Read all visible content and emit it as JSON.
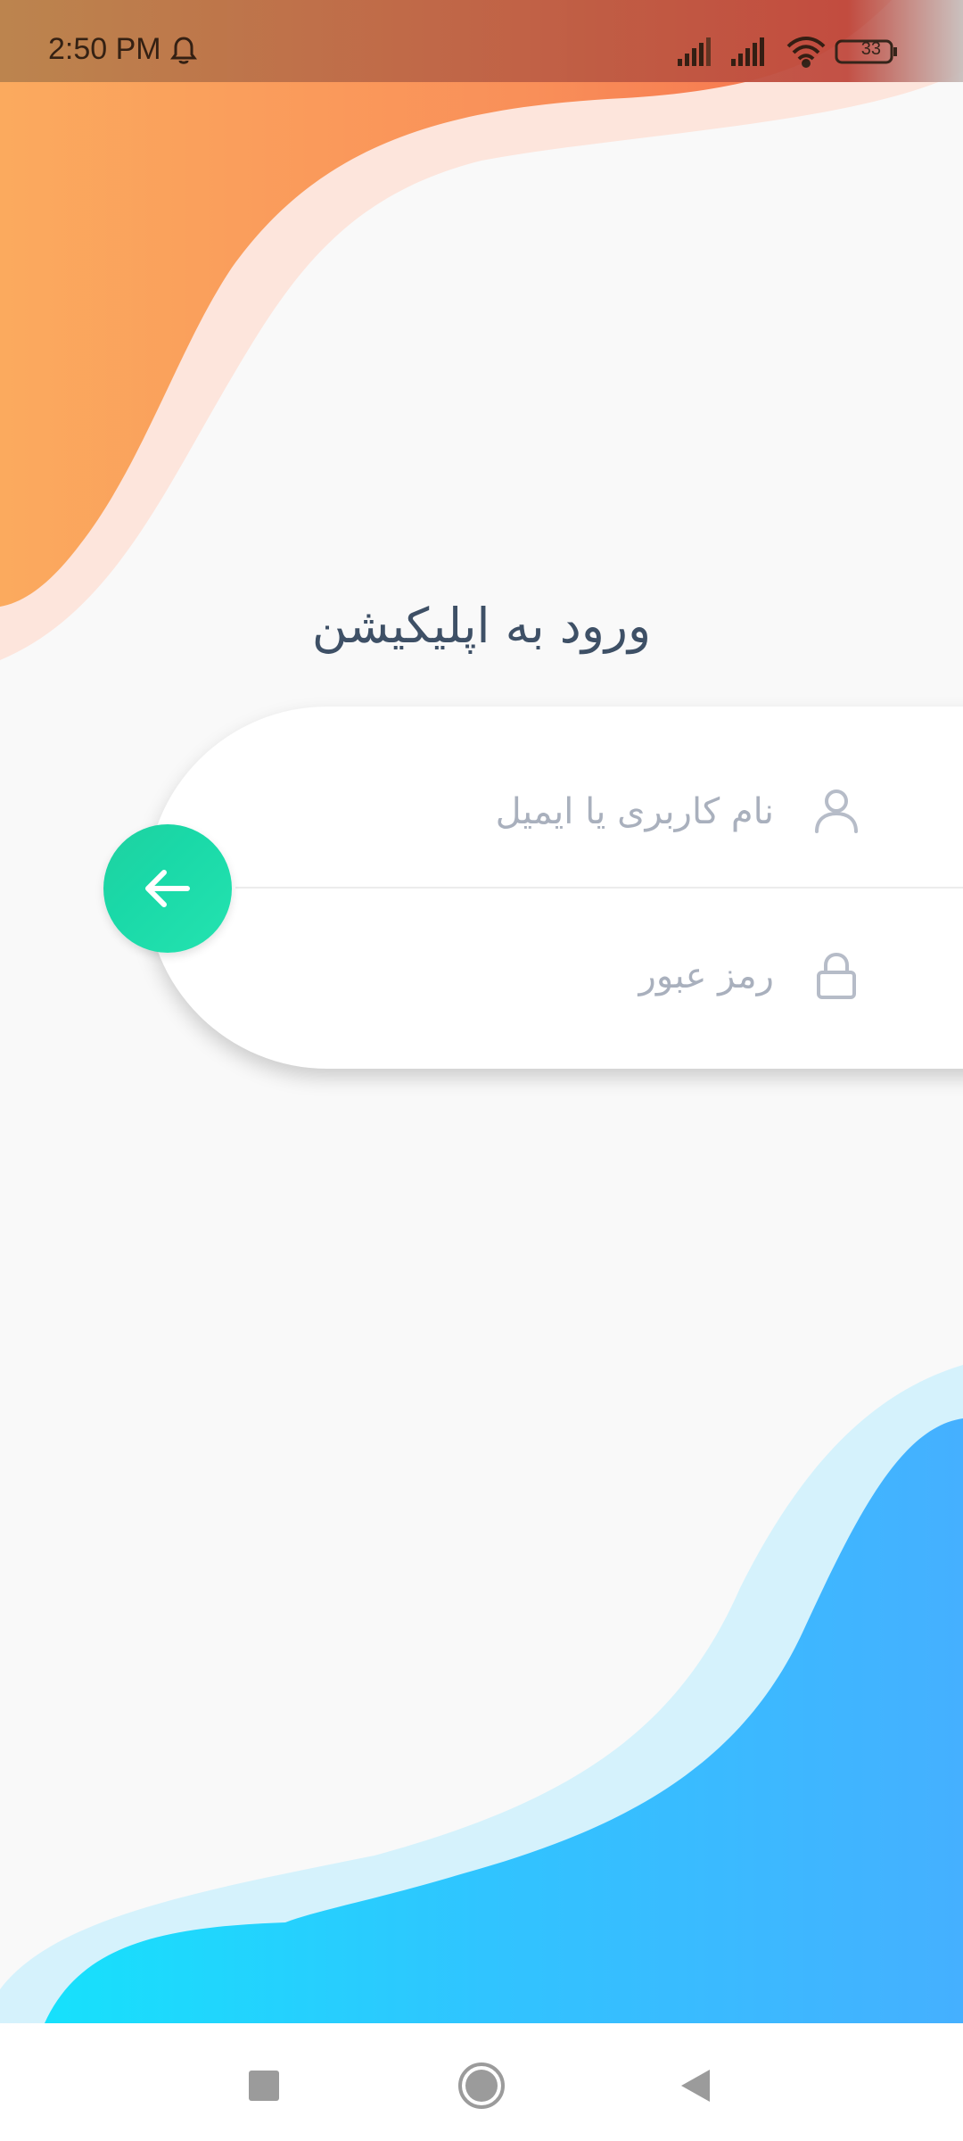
{
  "status_bar": {
    "time": "2:50 PM",
    "battery": "33",
    "icons": [
      "notification-bell-icon",
      "signal-icon",
      "signal-icon",
      "wifi-icon",
      "battery-icon"
    ]
  },
  "login": {
    "title": "ورود به اپلیکیشن",
    "username_placeholder": "نام کاربری یا ایمیل",
    "username_value": "",
    "password_placeholder": "رمز عبور",
    "password_value": "",
    "submit_icon": "arrow-left-icon",
    "username_icon": "user-icon",
    "password_icon": "lock-icon"
  },
  "nav": {
    "buttons": [
      "recents-square-icon",
      "home-circle-icon",
      "back-triangle-icon"
    ]
  },
  "colors": {
    "accent": "#1fd6a4",
    "title": "#3e5066",
    "placeholder": "#a9b0bd",
    "wave_top": "#f59a5a",
    "wave_bottom": "#2ebfff"
  }
}
